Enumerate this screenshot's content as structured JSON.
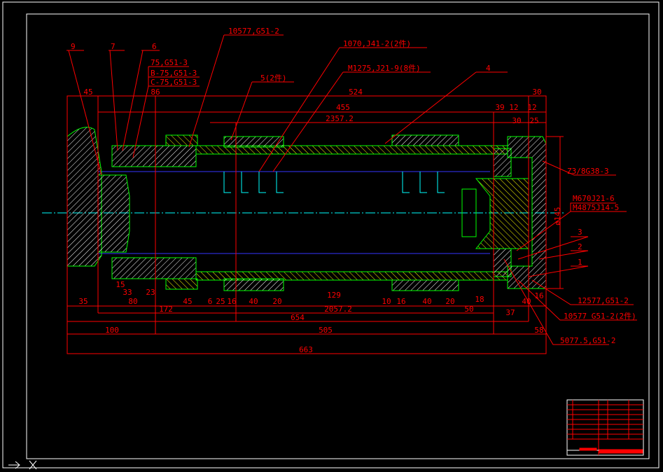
{
  "colors": {
    "background": "#000000",
    "frame": "#ffffff",
    "dimension": "#ff0000",
    "outline": "#00ff00",
    "hatch_section": "#ffffff",
    "hatch_shaft": "#ffff00",
    "centerline": "#00ffff",
    "bore": "#0000ff"
  },
  "leaders": {
    "part9": "9",
    "part7": "7",
    "part6": "6",
    "bearing_a": "75,G51-3",
    "bearing_b": "B-75,G51-3",
    "bearing_c": "C-75,G51-3",
    "ring_top": "10577,G51-2",
    "key": "1070,J41-2(2件)",
    "screw": "M1275,J21-9(8件)",
    "part5": "5(2件)",
    "part4": "4",
    "plug": "Z3/8G38-3",
    "nut1": "M670J21-6",
    "nut2": "M4875J14-5",
    "part3": "3",
    "part2": "2",
    "part1": "1",
    "ring_r1": "12577,G51-2",
    "ring_r2": "10577 G51-2(2件)",
    "ring_r3": "5077.5,G51-2",
    "diameter": "ø145"
  },
  "dims_top": [
    "45",
    "86",
    "524",
    "30",
    "455",
    "2357.2",
    "39 12",
    "12",
    "30",
    "25"
  ],
  "dims_bottom": [
    "15",
    "33",
    "23",
    "35",
    "80",
    "45",
    "6",
    "25",
    "16",
    "40",
    "20",
    "129",
    "10",
    "16",
    "40",
    "20",
    "18",
    "40",
    "16",
    "172",
    "2057.2",
    "50",
    "37",
    "654",
    "100",
    "505",
    "58",
    "663"
  ],
  "title_block": {
    "rows": 9
  }
}
